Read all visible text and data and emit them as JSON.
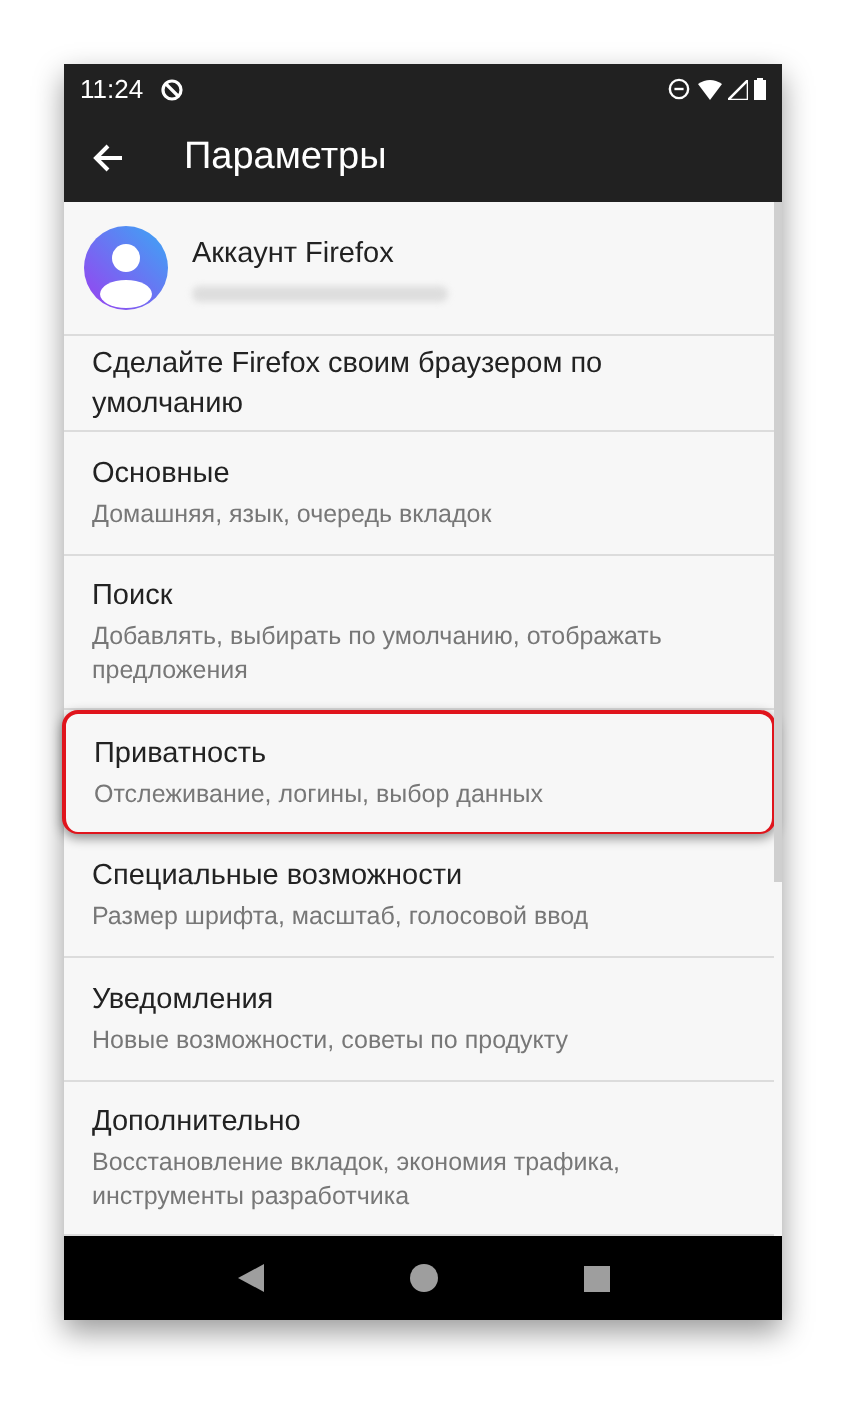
{
  "status_bar": {
    "time": "11:24"
  },
  "app_bar": {
    "title": "Параметры"
  },
  "account": {
    "title": "Аккаунт Firefox",
    "email_redacted": true
  },
  "items": [
    {
      "kind": "single",
      "title": "Сделайте Firefox своим браузером по умолчанию",
      "highlighted": false
    },
    {
      "kind": "double",
      "title": "Основные",
      "subtitle": "Домашняя, язык, очередь вкладок",
      "highlighted": false
    },
    {
      "kind": "double",
      "title": "Поиск",
      "subtitle": "Добавлять, выбирать по умолчанию, отображать предложения",
      "highlighted": false
    },
    {
      "kind": "double",
      "title": "Приватность",
      "subtitle": "Отслеживание, логины, выбор данных",
      "highlighted": true
    },
    {
      "kind": "double",
      "title": "Специальные возможности",
      "subtitle": "Размер шрифта, масштаб, голосовой ввод",
      "highlighted": false
    },
    {
      "kind": "double",
      "title": "Уведомления",
      "subtitle": "Новые возможности, советы по продукту",
      "highlighted": false
    },
    {
      "kind": "double",
      "title": "Дополнительно",
      "subtitle": "Восстановление вкладок, экономия трафика, инструменты разработчика",
      "highlighted": false
    }
  ]
}
